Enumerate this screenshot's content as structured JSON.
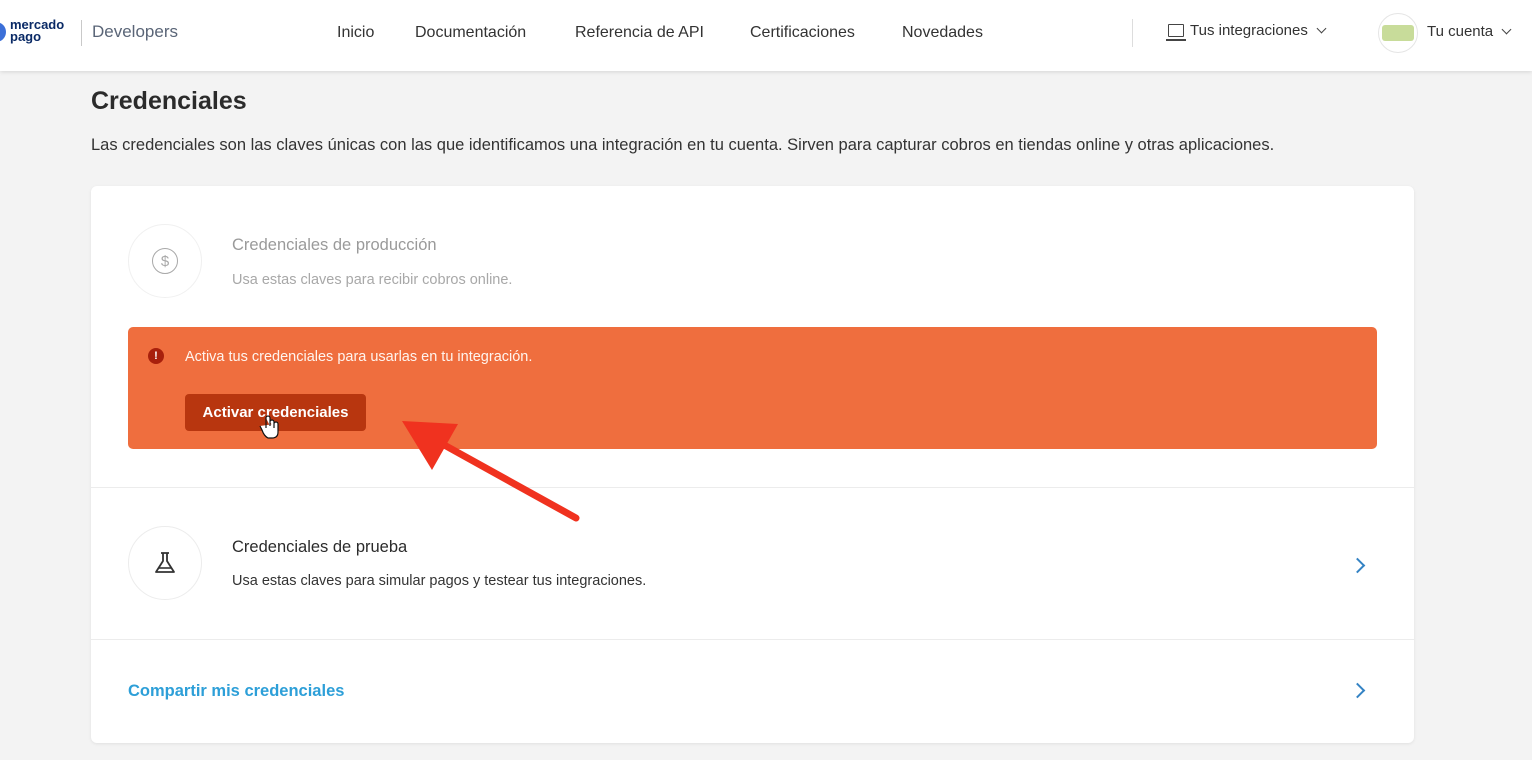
{
  "header": {
    "logo_line1": "mercado",
    "logo_line2": "pago",
    "brand": "Developers",
    "nav": [
      "Inicio",
      "Documentación",
      "Referencia de API",
      "Certificaciones",
      "Novedades"
    ],
    "integrations_label": "Tus integraciones",
    "account_label": "Tu cuenta"
  },
  "page": {
    "title": "Credenciales",
    "description": "Las credenciales son las claves únicas con las que identificamos una integración en tu cuenta. Sirven para capturar cobros en tiendas online y otras aplicaciones."
  },
  "production": {
    "title": "Credenciales de producción",
    "subtitle": "Usa estas claves para recibir cobros online.",
    "icon": "dollar-icon",
    "alert_message": "Activa tus credenciales para usarlas en tu integración.",
    "alert_badge": "!",
    "activate_button": "Activar credenciales",
    "alert_color": "#ef6e3e"
  },
  "test": {
    "title": "Credenciales de prueba",
    "subtitle": "Usa estas claves para simular pagos y testear tus integraciones.",
    "icon": "flask-icon"
  },
  "share": {
    "label": "Compartir mis credenciales",
    "color": "#2d9fd8"
  },
  "colors": {
    "accent_blue": "#3483c4",
    "annotation_arrow": "#f0321f"
  }
}
